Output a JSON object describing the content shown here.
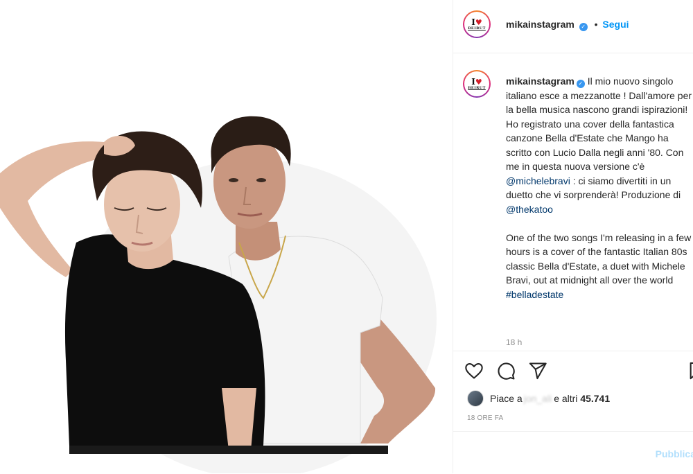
{
  "post": {
    "username": "mikainstagram",
    "verified_icon": "verified-badge-icon",
    "follow_separator": "•",
    "follow_label": "Segui",
    "avatar_logo_text": "I",
    "avatar_logo_heart": "♥",
    "avatar_logo_subtext": "BEIRUT"
  },
  "caption": {
    "username": "mikainstagram",
    "text_part1": "Il mio nuovo singolo italiano esce a mezzanotte ! Dall'amore per la bella musica nascono grandi ispirazioni! Ho registrato una cover della fantastica canzone Bella d'Estate che Mango ha scritto con Lucio Dalla negli anni '80. Con me in questa nuova versione c'è ",
    "mention1": "@michelebravi",
    "text_part2": " : ci siamo divertiti in un duetto che vi sorprenderà! Produzione di ",
    "mention2": "@thekatoo",
    "text_part3": "\n\nOne of the two songs I'm releasing in a few hours is a cover of the fantastic Italian 80s classic Bella d'Estate, a duet with Michele Bravi, out at midnight all over the world\n",
    "hashtag": "#belladestate",
    "time_ago": "18 h"
  },
  "actions": {
    "icons": [
      "heart-icon",
      "comment-icon",
      "share-icon",
      "bookmark-icon"
    ],
    "likes_prefix": "Piace a",
    "likes_user": "jon_ali",
    "likes_suffix": "e altri",
    "likes_count": "45.741",
    "date": "18 ORE FA"
  },
  "comment": {
    "publish_label": "Pubblica"
  },
  "colors": {
    "link": "#00376b",
    "follow": "#0095f6",
    "muted": "#8e8e8e",
    "border": "#efefef"
  }
}
